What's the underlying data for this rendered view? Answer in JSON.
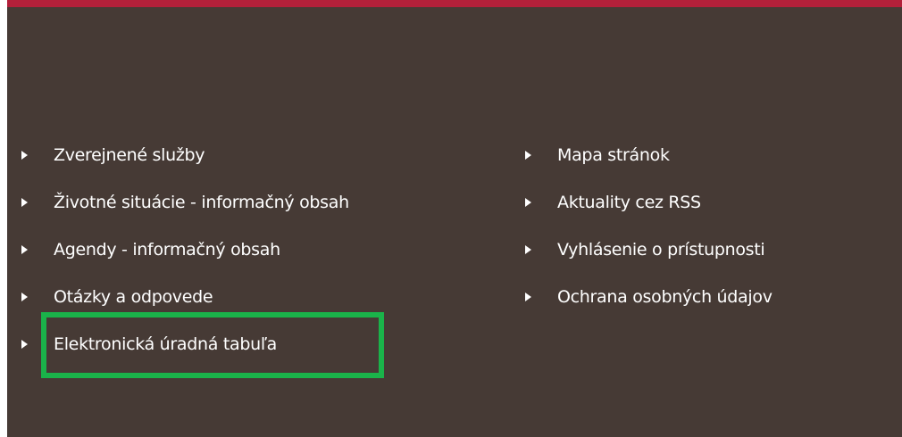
{
  "colors": {
    "footer_background": "#463a35",
    "top_bar": "#b3203a",
    "link_text": "#ffffff",
    "highlight_border": "#1ab34a"
  },
  "links_left": [
    {
      "label": "Zverejnené služby",
      "icon": "triangle-right-icon"
    },
    {
      "label": "Životné situácie - informačný obsah",
      "icon": "triangle-right-icon"
    },
    {
      "label": "Agendy - informačný obsah",
      "icon": "triangle-right-icon"
    },
    {
      "label": "Otázky a odpovede",
      "icon": "triangle-right-icon"
    },
    {
      "label": "Elektronická úradná tabuľa",
      "icon": "triangle-right-icon"
    }
  ],
  "links_right": [
    {
      "label": "Mapa stránok",
      "icon": "triangle-right-icon"
    },
    {
      "label": "Aktuality cez RSS",
      "icon": "triangle-right-icon"
    },
    {
      "label": "Vyhlásenie o prístupnosti",
      "icon": "triangle-right-icon"
    },
    {
      "label": "Ochrana osobných údajov",
      "icon": "triangle-right-icon"
    }
  ]
}
